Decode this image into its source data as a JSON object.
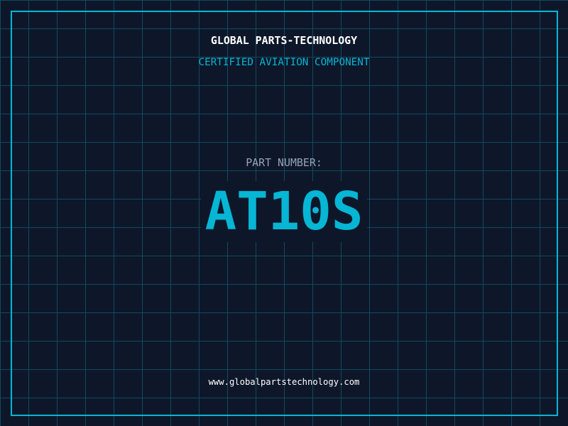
{
  "header": {
    "title": "GLOBAL PARTS-TECHNOLOGY",
    "subtitle": "CERTIFIED AVIATION COMPONENT"
  },
  "part": {
    "label": "PART NUMBER:",
    "number": "AT10S"
  },
  "footer": {
    "url": "www.globalpartstechnology.com"
  },
  "colors": {
    "background": "#0e172a",
    "accent": "#06b6d4",
    "grid": "#11495c",
    "label": "#94a3b8"
  }
}
